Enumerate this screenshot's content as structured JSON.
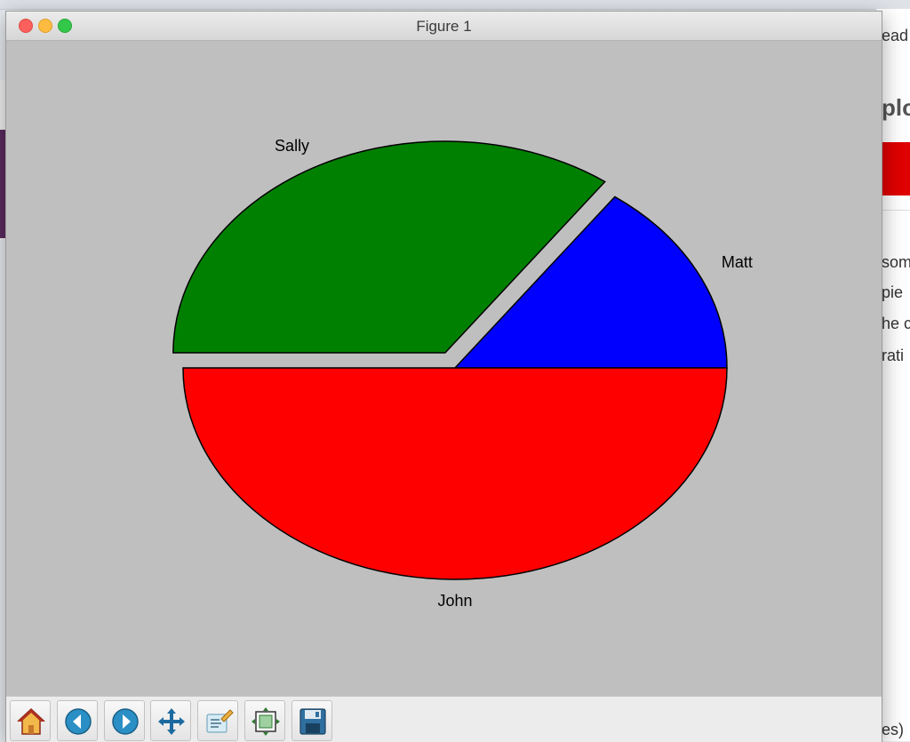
{
  "window": {
    "title": "Figure 1"
  },
  "background_window": {
    "fragments": [
      "ead",
      "plo",
      "som",
      "pie",
      "he c",
      "rati",
      "es)"
    ]
  },
  "chart_data": {
    "type": "pie",
    "start_angle_deg": 0,
    "counterclock": true,
    "aspect": "stretched",
    "slices": [
      {
        "label": "Matt",
        "value": 15,
        "color": "#0000ff",
        "explode": 0
      },
      {
        "label": "Sally",
        "value": 35,
        "color": "#008000",
        "explode": 0.08
      },
      {
        "label": "John",
        "value": 50,
        "color": "#ff0000",
        "explode": 0
      }
    ]
  },
  "toolbar": {
    "buttons": [
      {
        "name": "home",
        "icon": "home-icon"
      },
      {
        "name": "back",
        "icon": "back-arrow-icon"
      },
      {
        "name": "forward",
        "icon": "forward-arrow-icon"
      },
      {
        "name": "pan",
        "icon": "pan-icon"
      },
      {
        "name": "zoom",
        "icon": "zoom-icon"
      },
      {
        "name": "configure-subplots",
        "icon": "subplots-icon"
      },
      {
        "name": "save",
        "icon": "save-icon"
      }
    ]
  }
}
